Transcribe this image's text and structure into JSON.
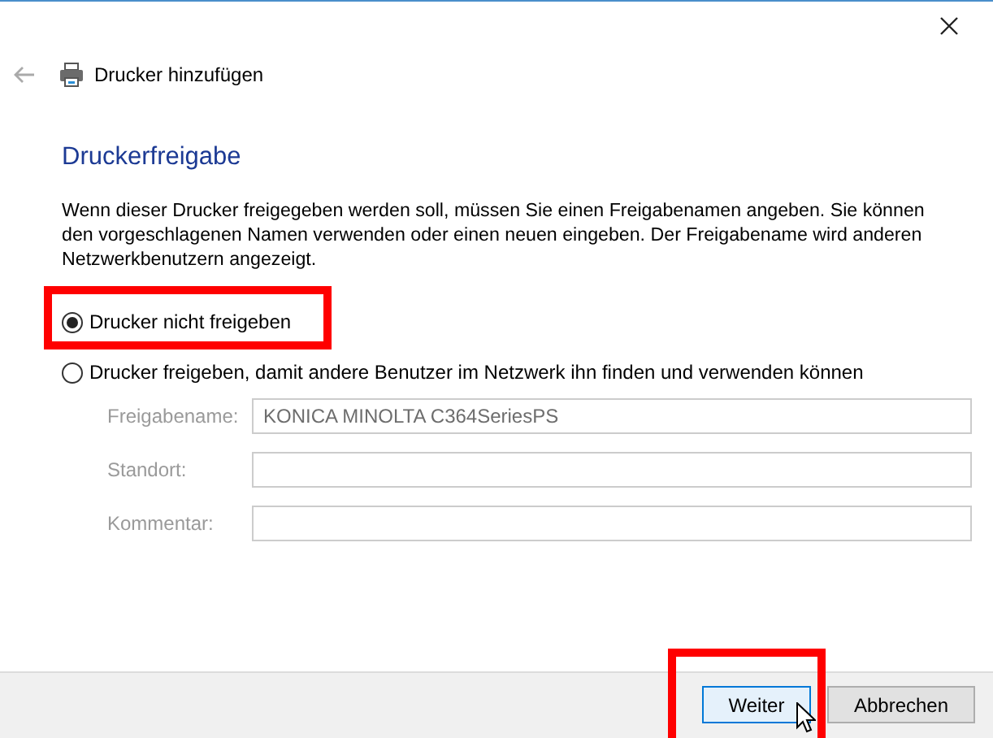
{
  "window": {
    "title": "Drucker hinzufügen"
  },
  "heading": "Druckerfreigabe",
  "description": "Wenn dieser Drucker freigegeben werden soll, müssen Sie einen Freigabenamen angeben. Sie können den vorgeschlagenen Namen verwenden oder einen neuen eingeben. Der Freigabename wird anderen Netzwerkbenutzern angezeigt.",
  "options": [
    {
      "label": "Drucker nicht freigeben",
      "selected": true,
      "highlighted": true
    },
    {
      "label": "Drucker freigeben, damit andere Benutzer im Netzwerk ihn finden und verwenden können",
      "selected": false,
      "highlighted": false
    }
  ],
  "fields": [
    {
      "label": "Freigabename:",
      "value": "KONICA MINOLTA C364SeriesPS",
      "disabled": true
    },
    {
      "label": "Standort:",
      "disabled": true
    },
    {
      "label": "Kommentar:",
      "disabled": true
    }
  ],
  "buttons": [
    {
      "label": "Weiter",
      "default": true,
      "highlighted": true
    },
    {
      "label": "Abbrechen",
      "default": false,
      "highlighted": false
    }
  ]
}
